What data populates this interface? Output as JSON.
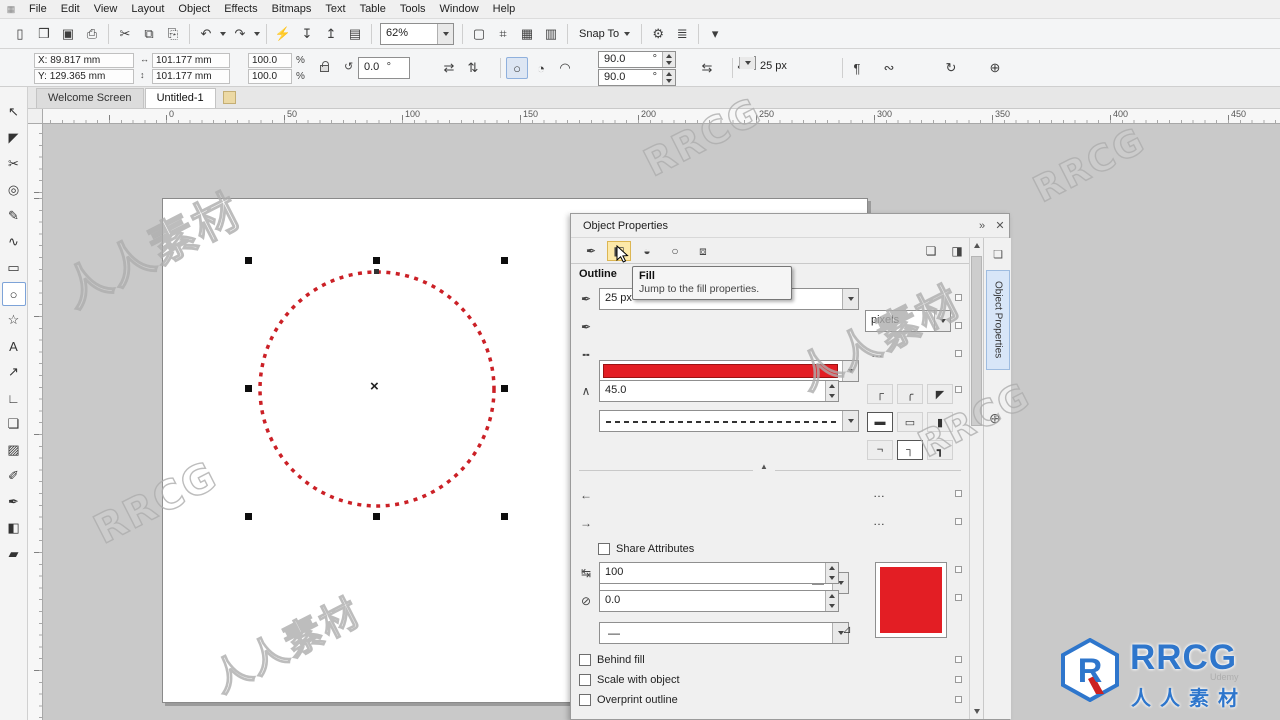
{
  "menu": {
    "app_icon_glyph": "▦",
    "items": [
      "File",
      "Edit",
      "View",
      "Layout",
      "Object",
      "Effects",
      "Bitmaps",
      "Text",
      "Table",
      "Tools",
      "Window",
      "Help"
    ]
  },
  "toolbar": {
    "zoom_value": "62%",
    "snap_label": "Snap To",
    "icons": [
      {
        "name": "new-document",
        "glyph": "▯"
      },
      {
        "name": "open",
        "glyph": "❒"
      },
      {
        "name": "save",
        "glyph": "▣"
      },
      {
        "name": "print",
        "glyph": "⎙"
      },
      {
        "name": "cut",
        "glyph": "✂"
      },
      {
        "name": "copy",
        "glyph": "⧉"
      },
      {
        "name": "paste",
        "glyph": "⎘"
      },
      {
        "name": "undo",
        "glyph": "↶"
      },
      {
        "name": "redo",
        "glyph": "↷"
      },
      {
        "name": "search-content",
        "glyph": "⚡"
      },
      {
        "name": "import",
        "glyph": "↧"
      },
      {
        "name": "export",
        "glyph": "↥"
      },
      {
        "name": "publish-pdf",
        "glyph": "▤"
      },
      {
        "name": "full-screen-preview",
        "glyph": "▢"
      },
      {
        "name": "show-rulers",
        "glyph": "⌗"
      },
      {
        "name": "show-grid",
        "glyph": "▦"
      },
      {
        "name": "show-guidelines",
        "glyph": "▥"
      },
      {
        "name": "options",
        "glyph": "⚙"
      },
      {
        "name": "application-launcher",
        "glyph": "≣"
      },
      {
        "name": "overflow",
        "glyph": "▾"
      }
    ]
  },
  "propbar": {
    "x_label": "X:",
    "x_value": "89.817 mm",
    "y_label": "Y:",
    "y_value": "129.365 mm",
    "width_value": "101.177 mm",
    "height_value": "101.177 mm",
    "scale_x": "100.0",
    "scale_y": "100.0",
    "percent": "%",
    "rotation_value": "0.0",
    "degree": "°",
    "angle_start": "90.0",
    "angle_end": "90.0",
    "outline_width": "25 px",
    "icons": [
      {
        "name": "size-horizontal",
        "glyph": "↔"
      },
      {
        "name": "size-vertical",
        "glyph": "↕"
      },
      {
        "name": "rotate",
        "glyph": "↺"
      },
      {
        "name": "mirror-horizontal",
        "glyph": "⇄"
      },
      {
        "name": "mirror-vertical",
        "glyph": "⇅"
      },
      {
        "name": "ellipse-mode",
        "glyph": "○"
      },
      {
        "name": "pie-mode",
        "glyph": "◔"
      },
      {
        "name": "arc-mode",
        "glyph": "◠"
      },
      {
        "name": "change-direction",
        "glyph": "⇆"
      },
      {
        "name": "outline-pen",
        "glyph": "✒"
      },
      {
        "name": "wrap-text",
        "glyph": "¶"
      },
      {
        "name": "convert-to-curves",
        "glyph": "∾"
      },
      {
        "name": "refresh",
        "glyph": "↻"
      },
      {
        "name": "add",
        "glyph": "⊕"
      }
    ]
  },
  "doc_tabs": {
    "items": [
      "Welcome Screen",
      "Untitled-1"
    ]
  },
  "ruler": {
    "marks": [
      "0",
      "50",
      "100",
      "150",
      "200",
      "250",
      "300",
      "350",
      "400",
      "450"
    ]
  },
  "toolbox": {
    "tools": [
      {
        "name": "pick-tool",
        "glyph": "↖"
      },
      {
        "name": "shape-tool",
        "glyph": "◤"
      },
      {
        "name": "crop-tool",
        "glyph": "✂"
      },
      {
        "name": "zoom-tool",
        "glyph": "◎"
      },
      {
        "name": "freehand-tool",
        "glyph": "✎"
      },
      {
        "name": "artistic-media-tool",
        "glyph": "∿"
      },
      {
        "name": "rectangle-tool",
        "glyph": "▭"
      },
      {
        "name": "ellipse-tool",
        "glyph": "○"
      },
      {
        "name": "polygon-tool",
        "glyph": "☆"
      },
      {
        "name": "text-tool",
        "glyph": "A"
      },
      {
        "name": "parallel-dimension-tool",
        "glyph": "↗"
      },
      {
        "name": "connector-tool",
        "glyph": "∟"
      },
      {
        "name": "drop-shadow-tool",
        "glyph": "❏"
      },
      {
        "name": "transparency-tool",
        "glyph": "▨"
      },
      {
        "name": "color-eyedropper-tool",
        "glyph": "✐"
      },
      {
        "name": "outline-pen-tool",
        "glyph": "✒"
      },
      {
        "name": "fill-tool",
        "glyph": "◧"
      },
      {
        "name": "interactive-fill-tool",
        "glyph": "▰"
      }
    ]
  },
  "canvas": {
    "center_marker": "×"
  },
  "docker": {
    "title": "Object Properties",
    "header_icons": {
      "dock_glyph": "»",
      "close_glyph": "✕"
    },
    "tabs": [
      {
        "name": "outline-tab",
        "glyph": "✒"
      },
      {
        "name": "fill-tab",
        "glyph": "◧"
      },
      {
        "name": "transparency-tab",
        "glyph": "◒"
      },
      {
        "name": "style-tab",
        "glyph": "○"
      },
      {
        "name": "transformation-tab",
        "glyph": "⧈"
      }
    ],
    "right_buttons": [
      {
        "name": "wrap-toggle-button",
        "glyph": "❏"
      },
      {
        "name": "docker-options-button",
        "glyph": "◨"
      }
    ],
    "section_title": "Outline",
    "width_value": "25 px",
    "units_value": "pixels",
    "miter_value": "45.0",
    "arrow_none": "—",
    "ellipsis": "…",
    "share_attributes_label": "Share Attributes",
    "stretch_value": "100",
    "tilt_value": "0.0",
    "behind_fill_label": "Behind fill",
    "scale_with_object_label": "Scale with object",
    "overprint_label": "Overprint outline",
    "row_icons": [
      {
        "name": "outline-width-icon",
        "glyph": "✒"
      },
      {
        "name": "outline-color-icon",
        "glyph": "✒"
      },
      {
        "name": "line-style-icon",
        "glyph": "╍"
      },
      {
        "name": "miter-limit-icon",
        "glyph": "∧"
      },
      {
        "name": "start-arrowhead-icon",
        "glyph": "←"
      },
      {
        "name": "end-arrowhead-icon",
        "glyph": "→"
      },
      {
        "name": "stretch-icon",
        "glyph": "↹"
      },
      {
        "name": "tilt-icon",
        "glyph": "⊘"
      }
    ],
    "corner_buttons": [
      "┌",
      "╭",
      "◤",
      "▬",
      "▭",
      "▮",
      "¬",
      "┐",
      "┓"
    ],
    "divider_glyph": "▲",
    "corner_adjust_glyph": "⊿",
    "strip_icon_glyph": "❏",
    "strip_plus_glyph": "⊕",
    "side_tab_label": "Object Properties",
    "tooltip": {
      "title": "Fill",
      "body": "Jump to the fill properties."
    }
  },
  "watermarks": {
    "items": [
      "人人素材",
      "RRCG",
      "人人素材",
      "RRCG",
      "人人素材",
      "RRCG",
      "RRCG"
    ]
  },
  "logo": {
    "letter": "R",
    "brand": "RRCG",
    "brand_cn": "人人素材",
    "platform": "Udemy"
  },
  "colors": {
    "accent_red": "#e31e24",
    "logo_blue": "#2e76cc",
    "highlight_yellow": "#fde9a9",
    "canvas_gray": "#c9c9c9"
  }
}
